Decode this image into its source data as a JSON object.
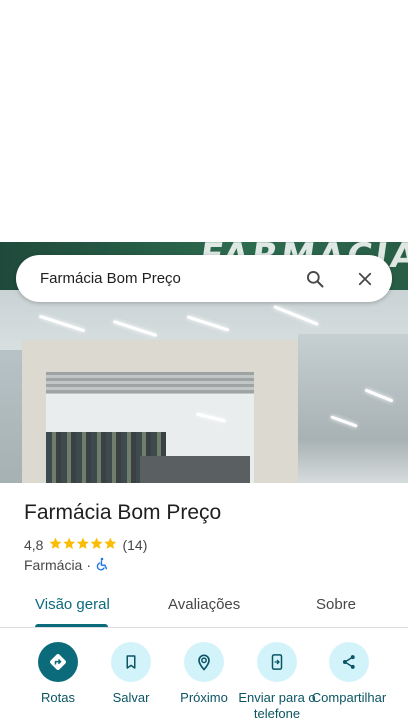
{
  "search": {
    "query": "Farmácia Bom Preço",
    "search_icon": "search-icon",
    "close_icon": "close-icon"
  },
  "photo": {
    "sign_text": "FARMÁCIA"
  },
  "place": {
    "name": "Farmácia Bom Preço",
    "rating": "4,8",
    "stars": 4.8,
    "review_count": "(14)",
    "category": "Farmácia",
    "separator": "·",
    "accessibility_icon": "wheelchair-icon"
  },
  "tabs": [
    {
      "label": "Visão geral",
      "active": true
    },
    {
      "label": "Avaliações",
      "active": false
    },
    {
      "label": "Sobre",
      "active": false
    }
  ],
  "actions": [
    {
      "label": "Rotas",
      "icon": "directions-icon",
      "primary": true
    },
    {
      "label": "Salvar",
      "icon": "bookmark-icon",
      "primary": false
    },
    {
      "label": "Próximo",
      "icon": "nearby-icon",
      "primary": false
    },
    {
      "label": "Enviar para o telefone",
      "icon": "send-to-phone-icon",
      "primary": false
    },
    {
      "label": "Compartilhar",
      "icon": "share-icon",
      "primary": false
    }
  ],
  "colors": {
    "accent": "#0b6b7a",
    "action_bg": "#d3f3fa",
    "star": "#fbbc04"
  }
}
